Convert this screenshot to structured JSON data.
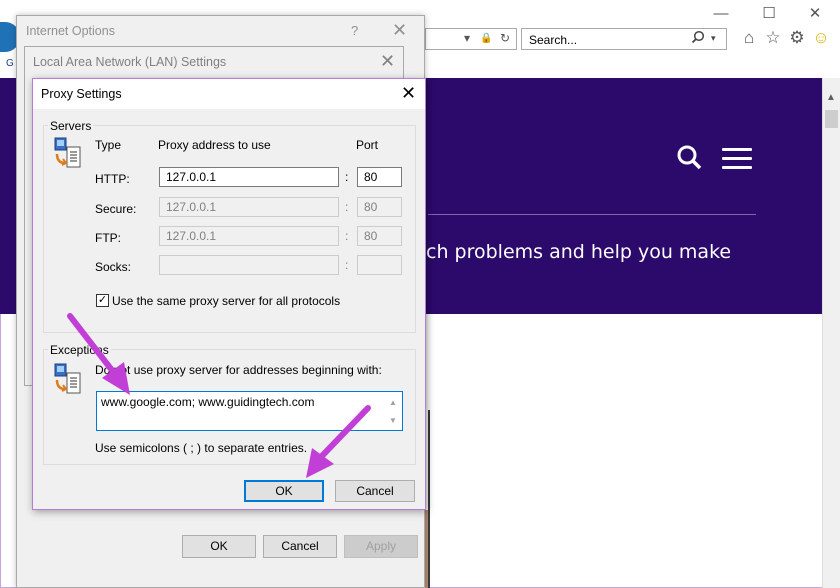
{
  "browser": {
    "minimize": "—",
    "maximize": "☐",
    "close": "✕",
    "address_dropdown": "▾",
    "lock_icon": "🔒",
    "refresh_icon": "↻",
    "search_placeholder": "Search...",
    "search_dropdown": "▾",
    "home_icon": "⌂",
    "favorites_icon": "☆",
    "tools_icon": "⚙",
    "feedback_icon": "☺",
    "page_tagline": "ch problems and help you make",
    "logo_letter": "G",
    "scroll_up": "▲"
  },
  "internet_options": {
    "title": "Internet Options",
    "help": "?",
    "close": "✕",
    "buttons": {
      "ok": "OK",
      "cancel": "Cancel",
      "apply": "Apply"
    }
  },
  "lan_settings": {
    "title": "Local Area Network (LAN) Settings",
    "close": "✕"
  },
  "proxy_settings": {
    "title": "Proxy Settings",
    "close": "✕",
    "servers": {
      "group_label": "Servers",
      "col_type": "Type",
      "col_address": "Proxy address to use",
      "col_port": "Port",
      "rows": [
        {
          "type": "HTTP:",
          "address": "127.0.0.1",
          "port": "80",
          "enabled": true
        },
        {
          "type": "Secure:",
          "address": "127.0.0.1",
          "port": "80",
          "enabled": false
        },
        {
          "type": "FTP:",
          "address": "127.0.0.1",
          "port": "80",
          "enabled": false
        },
        {
          "type": "Socks:",
          "address": "",
          "port": "",
          "enabled": false
        }
      ],
      "separator": ":",
      "same_proxy_label": "Use the same proxy server for all protocols",
      "same_proxy_checked": "✓"
    },
    "exceptions": {
      "group_label": "Exceptions",
      "description": "Do not use proxy server for addresses beginning with:",
      "value": "www.google.com; www.guidingtech.com",
      "scroll_up": "▲",
      "scroll_down": "▼",
      "hint": "Use semicolons ( ; ) to separate entries."
    },
    "buttons": {
      "ok": "OK",
      "cancel": "Cancel"
    }
  },
  "colors": {
    "page_purple": "#2c0a6b",
    "arrow_magenta": "#c13fd6",
    "focus_blue": "#0078d7"
  }
}
